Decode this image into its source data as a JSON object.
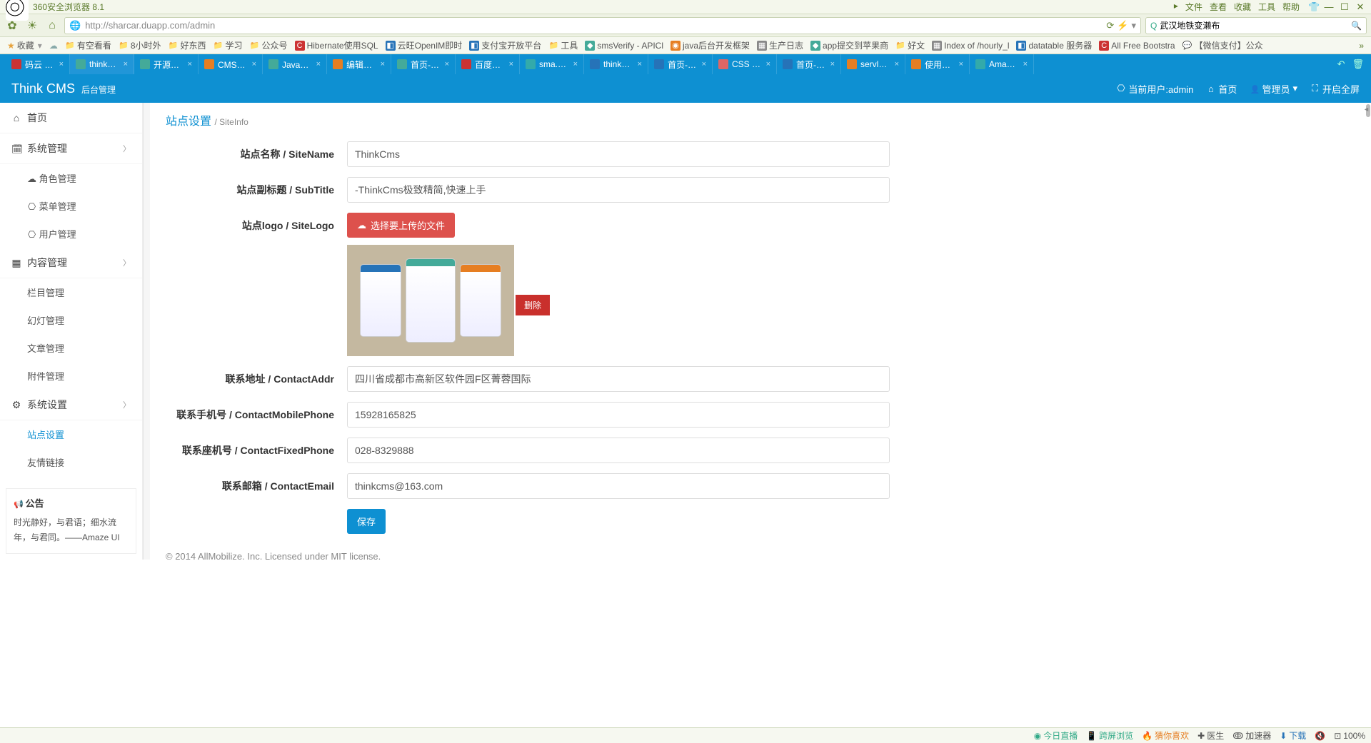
{
  "browser": {
    "title": "360安全浏览器 8.1",
    "top_menu": [
      "文件",
      "查看",
      "收藏",
      "工具",
      "帮助"
    ],
    "url": "http://sharcar.duapp.com/admin",
    "search_value": "武汉地铁变濑布",
    "fav_label": "收藏"
  },
  "bookmarks": [
    {
      "icon": "folder",
      "label": "有空看看"
    },
    {
      "icon": "folder",
      "label": "8小时外"
    },
    {
      "icon": "folder",
      "label": "好东西"
    },
    {
      "icon": "folder",
      "label": "学习"
    },
    {
      "icon": "folder",
      "label": "公众号"
    },
    {
      "icon": "red",
      "label": "Hibernate使用SQL"
    },
    {
      "icon": "blue",
      "label": "云旺OpenIM即时"
    },
    {
      "icon": "blue",
      "label": "支付宝开放平台"
    },
    {
      "icon": "folder",
      "label": "工具"
    },
    {
      "icon": "green",
      "label": "smsVerify - APICl"
    },
    {
      "icon": "orange",
      "label": "java后台开发框架"
    },
    {
      "icon": "gray",
      "label": "生产日志"
    },
    {
      "icon": "green",
      "label": "app提交到苹果商"
    },
    {
      "icon": "folder",
      "label": "好文"
    },
    {
      "icon": "gray",
      "label": "Index of /hourly_l"
    },
    {
      "icon": "blue",
      "label": "datatable 服务器"
    },
    {
      "icon": "red",
      "label": "All Free Bootstra"
    },
    {
      "icon": "wx",
      "label": "【微信支付】公众"
    }
  ],
  "tabs": [
    {
      "icon": "red",
      "label": "码云 - 开",
      "active": false
    },
    {
      "icon": "green",
      "label": "thinkcms",
      "active": true
    },
    {
      "icon": "green",
      "label": "开源中国",
      "active": false
    },
    {
      "icon": "orange",
      "label": "CMS内容",
      "active": false
    },
    {
      "icon": "green",
      "label": "Java后台",
      "active": false
    },
    {
      "icon": "orange",
      "label": "编辑作品",
      "active": false
    },
    {
      "icon": "green",
      "label": "首页-Thi",
      "active": false
    },
    {
      "icon": "red",
      "label": "百度开放",
      "active": false
    },
    {
      "icon": "teal",
      "label": "sma.dua",
      "active": false
    },
    {
      "icon": "blue",
      "label": "thinkcms",
      "active": false
    },
    {
      "icon": "blue",
      "label": "首页-Thi",
      "active": false
    },
    {
      "icon": "pink",
      "label": "CSS · Icc",
      "active": false
    },
    {
      "icon": "blue",
      "label": "首页-Thi",
      "active": false
    },
    {
      "icon": "orange",
      "label": "servletre",
      "active": false
    },
    {
      "icon": "orange",
      "label": "使用Serv",
      "active": false
    },
    {
      "icon": "teal",
      "label": "Amaze U",
      "active": false
    }
  ],
  "header": {
    "brand": "Think CMS",
    "brand_sub": "后台管理",
    "user_label": "当前用户:admin",
    "home_label": "首页",
    "admin_label": "管理员",
    "fullscreen_label": "开启全屏"
  },
  "sidebar": {
    "items": [
      {
        "icon": "home",
        "label": "首页",
        "type": "item"
      },
      {
        "icon": "cal",
        "label": "系统管理",
        "type": "group"
      },
      {
        "icon": "cloud",
        "label": "角色管理",
        "type": "sub"
      },
      {
        "icon": "gh",
        "label": "菜单管理",
        "type": "sub"
      },
      {
        "icon": "gh",
        "label": "用户管理",
        "type": "sub"
      },
      {
        "icon": "grid",
        "label": "内容管理",
        "type": "group"
      },
      {
        "icon": "",
        "label": "栏目管理",
        "type": "sub"
      },
      {
        "icon": "",
        "label": "幻灯管理",
        "type": "sub"
      },
      {
        "icon": "",
        "label": "文章管理",
        "type": "sub"
      },
      {
        "icon": "",
        "label": "附件管理",
        "type": "sub"
      },
      {
        "icon": "gear",
        "label": "系统设置",
        "type": "group"
      },
      {
        "icon": "",
        "label": "站点设置",
        "type": "sub",
        "active": true
      },
      {
        "icon": "",
        "label": "友情链接",
        "type": "sub"
      }
    ],
    "notice_title": "公告",
    "notice_body": "时光静好，与君语；细水流年，与君同。——Amaze UI"
  },
  "page": {
    "title": "站点设置",
    "subtitle": "/ SiteInfo",
    "labels": {
      "siteName": "站点名称 / SiteName",
      "subTitle": "站点副标题 / SubTitle",
      "siteLogo": "站点logo / SiteLogo",
      "uploadBtn": "选择要上传的文件",
      "deleteBtn": "删除",
      "contactAddr": "联系地址 / ContactAddr",
      "contactMobile": "联系手机号 / ContactMobilePhone",
      "contactFixed": "联系座机号 / ContactFixedPhone",
      "contactEmail": "联系邮箱 / ContactEmail",
      "saveBtn": "保存"
    },
    "values": {
      "siteName": "ThinkCms",
      "subTitle": "-ThinkCms极致精简,快速上手",
      "contactAddr": "四川省成都市高新区软件园F区菁蓉国际",
      "contactMobile": "15928165825",
      "contactFixed": "028-8329888",
      "contactEmail": "thinkcms@163.com"
    },
    "footer": "© 2014 AllMobilize, Inc. Licensed under MIT license."
  },
  "statusbar": {
    "items": [
      "今日直播",
      "跨屏浏览",
      "猜你喜欢",
      "医生",
      "加速器",
      "下载",
      "ღ",
      "100%"
    ]
  }
}
